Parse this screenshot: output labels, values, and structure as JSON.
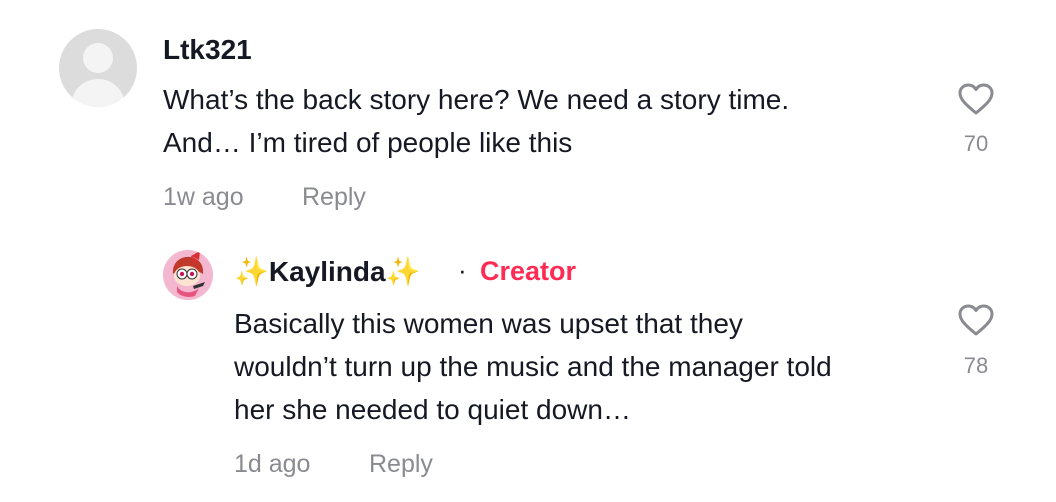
{
  "comments": [
    {
      "username": "Ltk321",
      "text": "What’s the back story here? We need a story time.\nAnd… I’m tired of people like this",
      "time": "1w ago",
      "reply_label": "Reply",
      "like_count": "70"
    }
  ],
  "reply": {
    "sparkle_left": "✨",
    "username": "Kaylinda",
    "sparkle_right": "✨",
    "separator": "·",
    "creator_label": "Creator",
    "text": "Basically this women was upset that they\nwouldn’t turn up the music and the manager told\nher she needed to quiet down…",
    "time": "1d ago",
    "reply_label": "Reply",
    "like_count": "78"
  },
  "colors": {
    "text": "#161823",
    "muted": "#8a8b91",
    "creator": "#fe2c55",
    "heart_outline": "#8a8b91"
  },
  "icons": {
    "like": "heart-outline-icon",
    "avatar": "default-user-avatar"
  }
}
